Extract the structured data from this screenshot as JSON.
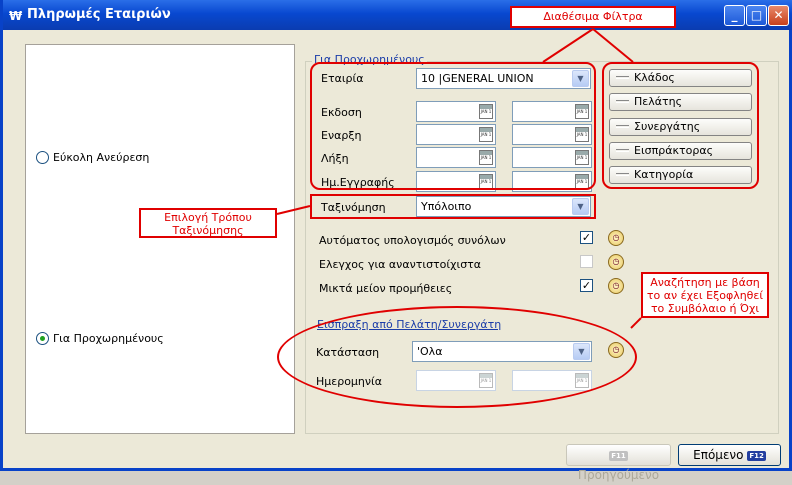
{
  "window": {
    "title": "Πληρωμές Εταιριών",
    "icon": "app-logo-icon"
  },
  "left": {
    "option_easy_search": "Εύκολη Ανεύρεση",
    "option_overdue": "Για Προχωρημένους"
  },
  "group_title": "Για Προχωρημένους",
  "fields": {
    "company_label": "Εταιρία",
    "company_value": "10 |GENERAL UNION",
    "issue_label": "Εκδοση",
    "start_label": "Εναρξη",
    "end_label": "Λήξη",
    "registration_label": "Ημ.Εγγραφής",
    "sort_label": "Ταξινόμηση",
    "sort_value": "Υπόλοιπο"
  },
  "calendar_icon_text": "JAN 1",
  "checks": {
    "auto_totals": "Αυτόματος υπολογισμός συνόλων",
    "mismatch": "Ελεγχος για αναντιστοίχιστα",
    "net_commission": "Μικτά μείον προμήθειες"
  },
  "collection": {
    "title": "Εισπραξη από Πελάτη/Συνεργάτη",
    "status_label": "Κατάσταση",
    "status_value": "'Ολα",
    "date_label": "Ημερομηνία"
  },
  "filters": {
    "items": [
      "Κλάδος",
      "Πελάτης",
      "Συνεργάτης",
      "Εισπράκτορας",
      "Κατηγορία"
    ]
  },
  "annotations": {
    "available_filters": "Διαθέσιμα Φίλτρα",
    "sort_mode": "Επιλογή Τρόπου Ταξινόμησης",
    "search_paid": "Αναζήτηση με βάση το αν έχει Εξοφληθεί το Συμβόλαιο ή Όχι"
  },
  "buttons": {
    "previous": "Προηγούμενο",
    "previous_key": "F11",
    "next": "Επόμενο",
    "next_key": "F12"
  },
  "colors": {
    "annotation": "#e00000",
    "title_bar": "#0848d0"
  }
}
